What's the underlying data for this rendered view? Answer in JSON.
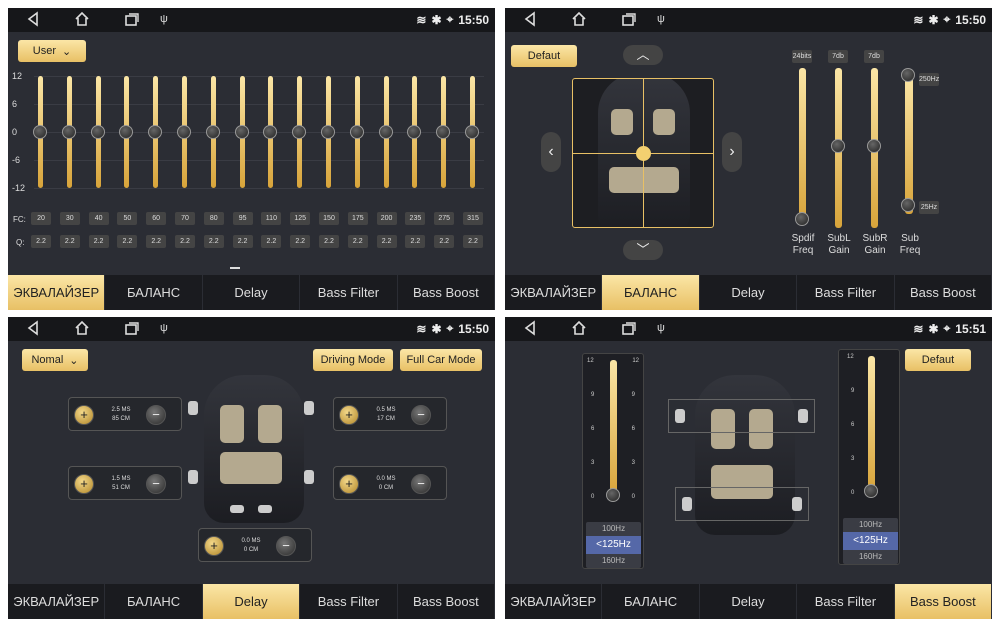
{
  "status": {
    "time1": "15:50",
    "time2": "15:50",
    "time3": "15:50",
    "time4": "15:51"
  },
  "tabs": [
    "ЭКВАЛАЙЗЕР",
    "БАЛАНС",
    "Delay",
    "Bass Filter",
    "Bass Boost"
  ],
  "eq": {
    "preset": "User",
    "scale": [
      "12",
      "6",
      "0",
      "-6",
      "-12"
    ],
    "fc_label": "FC:",
    "q_label": "Q:",
    "fc": [
      "20",
      "30",
      "40",
      "50",
      "60",
      "70",
      "80",
      "95",
      "110",
      "125",
      "150",
      "175",
      "200",
      "235",
      "275",
      "315"
    ],
    "q": [
      "2.2",
      "2.2",
      "2.2",
      "2.2",
      "2.2",
      "2.2",
      "2.2",
      "2.2",
      "2.2",
      "2.2",
      "2.2",
      "2.2",
      "2.2",
      "2.2",
      "2.2",
      "2.2"
    ],
    "gains": [
      0,
      0,
      0,
      0,
      0,
      0,
      0,
      0,
      0,
      0,
      0,
      0,
      0,
      0,
      0,
      0
    ]
  },
  "balance": {
    "default_label": "Defaut",
    "chips": [
      "24bits",
      "7db",
      "7db",
      "250Hz",
      "25Hz"
    ],
    "labels": [
      [
        "Spdif",
        "Freq"
      ],
      [
        "SubL",
        "Gain"
      ],
      [
        "SubR",
        "Gain"
      ],
      [
        "Sub",
        "Freq"
      ]
    ]
  },
  "delay": {
    "mode": "Nomal",
    "driving_mode": "Driving Mode",
    "full_car_mode": "Full Car Mode",
    "channels": [
      {
        "ms": "2.5 MS",
        "cm": "85 CM"
      },
      {
        "ms": "0.5 MS",
        "cm": "17 CM"
      },
      {
        "ms": "1.5 MS",
        "cm": "51 CM"
      },
      {
        "ms": "0.0 MS",
        "cm": "0 CM"
      },
      {
        "ms": "0.0 MS",
        "cm": "0 CM"
      }
    ]
  },
  "boost": {
    "default_label": "Defaut",
    "scale": [
      "12",
      "9",
      "6",
      "3",
      "0"
    ],
    "freqs": [
      "100Hz",
      "<125Hz",
      "160Hz"
    ]
  },
  "colors": {
    "accent": "#e8c065",
    "panel": "#2b2d34",
    "selected_freq": "#5568a8"
  }
}
